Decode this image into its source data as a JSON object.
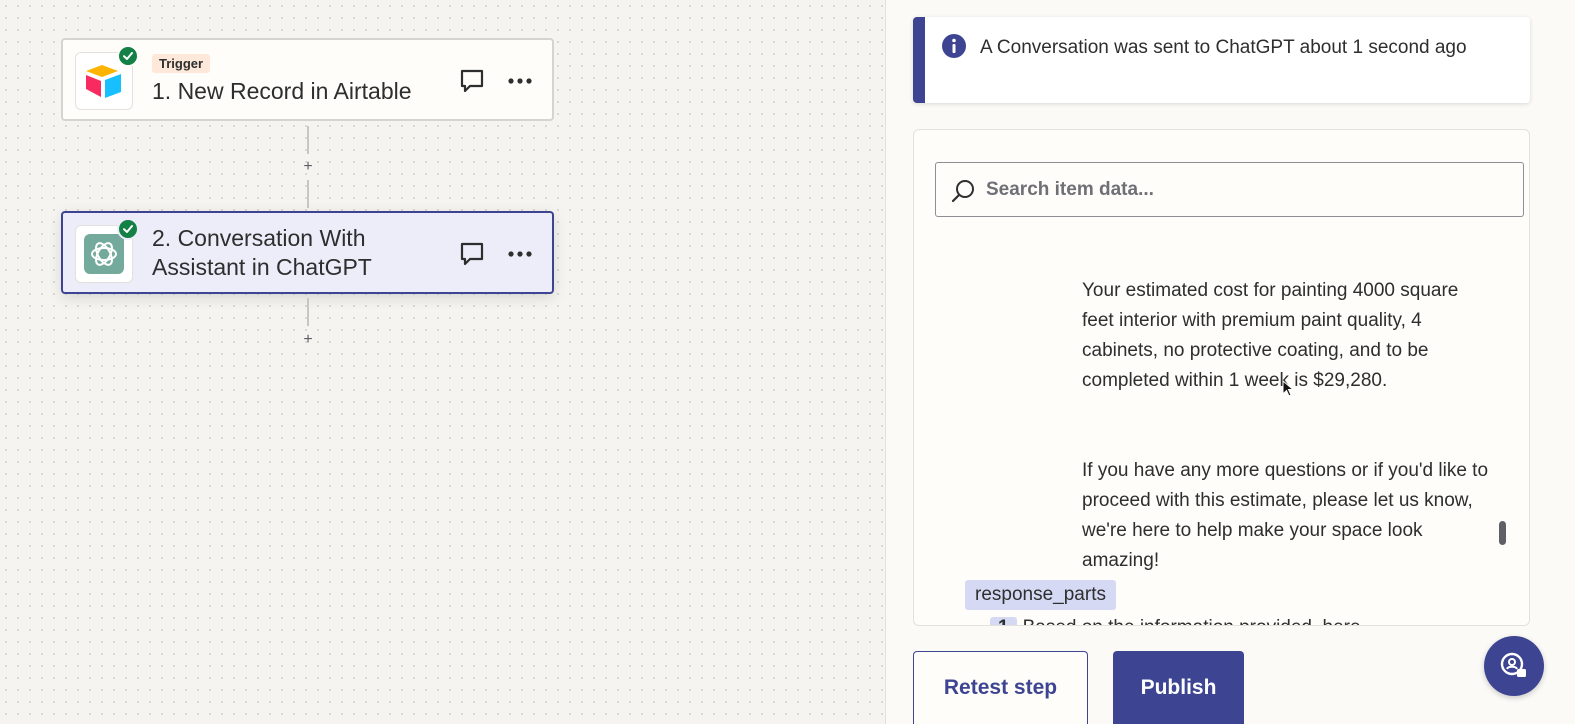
{
  "canvas": {
    "steps": [
      {
        "tag": "Trigger",
        "title": "1. New Record in Airtable",
        "app_icon": "airtable-logo-icon",
        "status": "complete"
      },
      {
        "title": "2. Conversation With Assistant in ChatGPT",
        "app_icon": "chatgpt-logo-icon",
        "status": "complete",
        "selected": true
      }
    ],
    "add_step_label": "+"
  },
  "panel": {
    "alert": {
      "text": "A Conversation was sent to ChatGPT about 1 second ago",
      "icon": "info-icon"
    },
    "search": {
      "placeholder": "Search item data..."
    },
    "response": {
      "paragraph1": "Your estimated cost for painting 4000 square feet interior with premium paint quality, 4 cabinets, no protective coating, and to be completed within 1 week is $29,280.",
      "paragraph2": "If you have any more questions or if you'd like to proceed with this estimate, please let us know, we're here to help make your space look amazing!"
    },
    "key_label": "response_parts",
    "sub_item": {
      "index": "1",
      "text": "Based on the information provided, here"
    },
    "buttons": {
      "retest": "Retest step",
      "publish": "Publish"
    }
  },
  "colors": {
    "accent": "#3d4592",
    "success": "#138046",
    "trigger_tag_bg": "#fde8d9",
    "key_tag_bg": "#d6d9f4"
  }
}
